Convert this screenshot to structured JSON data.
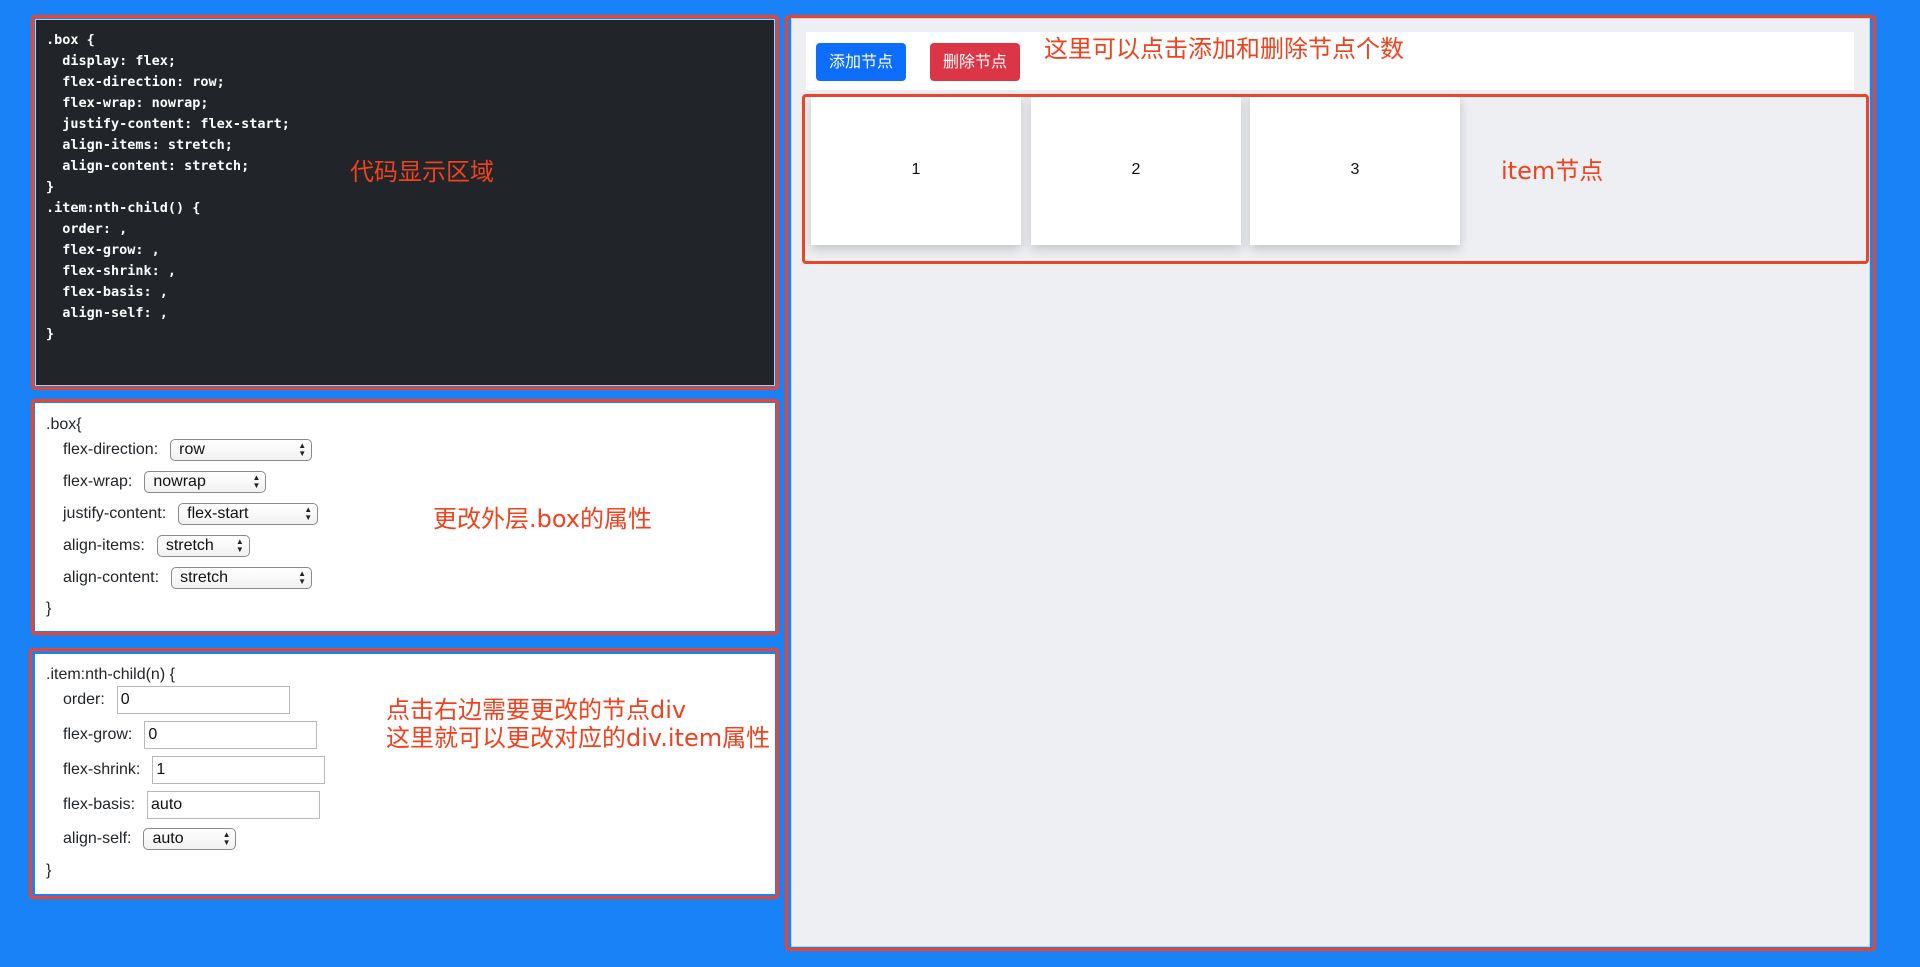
{
  "code_panel": {
    "lines": [
      ".box {",
      "  display: flex;",
      "  flex-direction: row;",
      "  flex-wrap: nowrap;",
      "  justify-content: flex-start;",
      "  align-items: stretch;",
      "  align-content: stretch;",
      "}",
      ".item:nth-child() {",
      "  order: ,",
      "  flex-grow: ,",
      "  flex-shrink: ,",
      "  flex-basis: ,",
      "  align-self: ,",
      "}"
    ]
  },
  "box_panel": {
    "open": ".box{",
    "close": "}",
    "fields": [
      {
        "label": "flex-direction:",
        "value": "row"
      },
      {
        "label": "flex-wrap:",
        "value": "nowrap"
      },
      {
        "label": "justify-content:",
        "value": "flex-start"
      },
      {
        "label": "align-items:",
        "value": "stretch"
      },
      {
        "label": "align-content:",
        "value": "stretch"
      }
    ]
  },
  "item_panel": {
    "open": ".item:nth-child(n) {",
    "close": "}",
    "order": {
      "label": "order:",
      "value": "0"
    },
    "flex_grow": {
      "label": "flex-grow:",
      "value": "0"
    },
    "flex_shrink": {
      "label": "flex-shrink:",
      "value": "1"
    },
    "flex_basis": {
      "label": "flex-basis:",
      "value": "auto"
    },
    "align_self": {
      "label": "align-self:",
      "value": "auto"
    }
  },
  "toolbar": {
    "add_label": "添加节点",
    "delete_label": "删除节点"
  },
  "items": [
    "1",
    "2",
    "3"
  ],
  "annotations": {
    "code_area": "代码显示区域",
    "box_props": "更改外层.box的属性",
    "item_note_1": "点击右边需要更改的节点div",
    "item_note_2": "这里就可以更改对应的div.item属性",
    "toolbar_note": "这里可以点击添加和删除节点个数",
    "item_nodes": "item节点"
  },
  "colors": {
    "background": "#1a82f7",
    "annotation_red": "#e8452c",
    "add_button": "#0d6efd",
    "delete_button": "#dc3545",
    "code_bg": "#212529"
  }
}
